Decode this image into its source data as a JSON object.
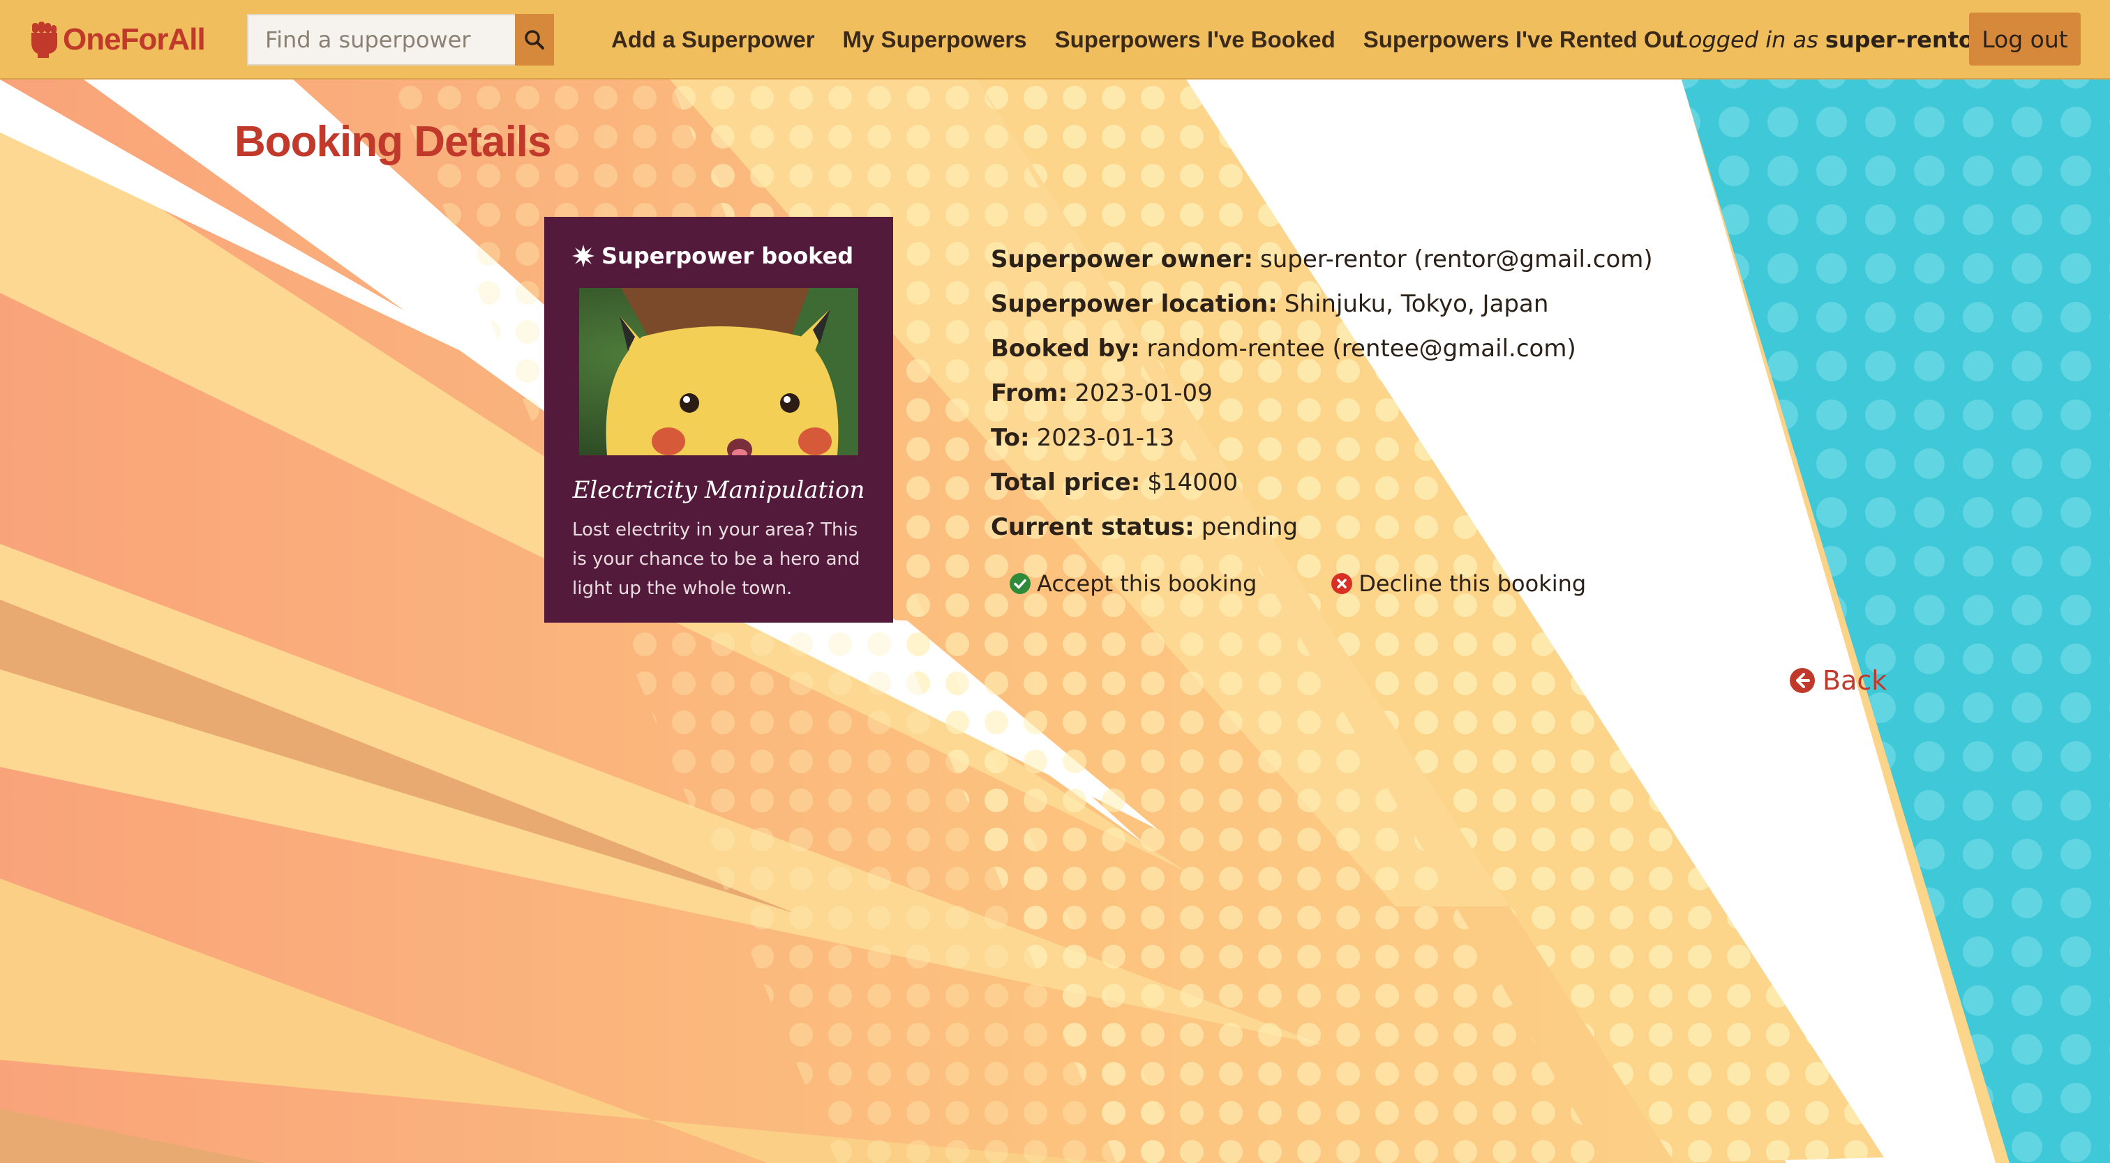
{
  "navbar": {
    "brand": "OneForAll",
    "search_placeholder": "Find a superpower",
    "links": [
      "Add a Superpower",
      "My Superpowers",
      "Superpowers I've Booked",
      "Superpowers I've Rented Out"
    ],
    "logged_in_label": "Logged in as",
    "username": "super-rentor",
    "logout_label": "Log out"
  },
  "page": {
    "title": "Booking Details"
  },
  "card": {
    "header": "Superpower booked",
    "title": "Electricity Manipulation",
    "description": "Lost electrity in your area? This is your chance to be a hero and light up the whole town."
  },
  "details": [
    {
      "label": "Superpower owner:",
      "value": "super-rentor (rentor@gmail.com)"
    },
    {
      "label": "Superpower location:",
      "value": "Shinjuku, Tokyo, Japan"
    },
    {
      "label": "Booked by:",
      "value": "random-rentee (rentee@gmail.com)"
    },
    {
      "label": "From:",
      "value": "2023-01-09"
    },
    {
      "label": "To:",
      "value": "2023-01-13"
    },
    {
      "label": "Total price:",
      "value": "$14000"
    },
    {
      "label": "Current status:",
      "value": "pending"
    }
  ],
  "actions": {
    "accept": "Accept this booking",
    "decline": "Decline this booking"
  },
  "back_label": "Back",
  "colors": {
    "navbar": "#f0be5c",
    "brand": "#c0392b",
    "card": "#541a3c",
    "accent_button": "#d6893a",
    "accept": "#2e8b3a",
    "decline": "#d93025",
    "teal_panel": "#3fc8d8"
  },
  "icons": {
    "brand": "fist-icon",
    "search": "search-icon",
    "card_header": "starburst-icon",
    "accept": "check-circle-icon",
    "decline": "x-circle-icon",
    "back": "arrow-left-circle-icon"
  }
}
